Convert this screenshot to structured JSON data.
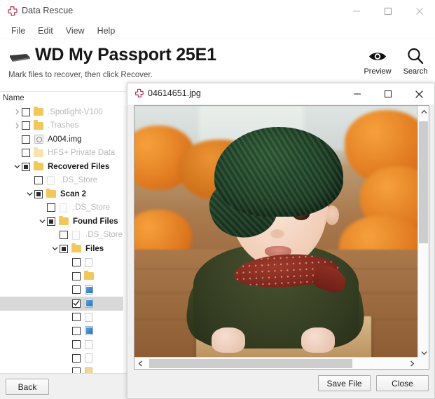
{
  "window": {
    "app_logo": "data-rescue-cross-logo",
    "title": "Data Rescue",
    "controls": {
      "minimize": "minimize-icon",
      "maximize": "maximize-icon",
      "close": "close-icon"
    }
  },
  "menubar": {
    "items": [
      {
        "label": "File"
      },
      {
        "label": "Edit"
      },
      {
        "label": "View"
      },
      {
        "label": "Help"
      }
    ]
  },
  "drive_header": {
    "icon": "hard-drive-icon",
    "title": "WD My Passport 25E1",
    "subtitle": "Mark files to recover, then click Recover.",
    "actions": [
      {
        "icon": "eye-icon",
        "label": "Preview"
      },
      {
        "icon": "search-icon",
        "label": "Search"
      }
    ]
  },
  "list_header": {
    "name_column": "Name"
  },
  "tree": {
    "rows": [
      {
        "indent": 1,
        "twisty": "collapsed",
        "check": "unchecked",
        "icon": "folder",
        "label": ".Spotlight-V100",
        "dim": true,
        "bold": false,
        "selected": false
      },
      {
        "indent": 1,
        "twisty": "collapsed",
        "check": "unchecked",
        "icon": "folder",
        "label": ".Trashes",
        "dim": true,
        "bold": false,
        "selected": false
      },
      {
        "indent": 1,
        "twisty": "none",
        "check": "unchecked",
        "icon": "disk",
        "label": "A004.img",
        "dim": false,
        "bold": false,
        "selected": false
      },
      {
        "indent": 1,
        "twisty": "none",
        "check": "unchecked",
        "icon": "folder-pale",
        "label": "HFS+ Private Data",
        "dim": true,
        "bold": false,
        "selected": false
      },
      {
        "indent": 1,
        "twisty": "expanded",
        "check": "partial",
        "icon": "folder",
        "label": "Recovered Files",
        "dim": false,
        "bold": true,
        "selected": false
      },
      {
        "indent": 2,
        "twisty": "none",
        "check": "unchecked",
        "icon": "doc-pale",
        "label": ".DS_Store",
        "dim": true,
        "bold": false,
        "selected": false
      },
      {
        "indent": 2,
        "twisty": "expanded",
        "check": "partial",
        "icon": "folder",
        "label": "Scan 2",
        "dim": false,
        "bold": true,
        "selected": false
      },
      {
        "indent": 3,
        "twisty": "none",
        "check": "unchecked",
        "icon": "doc-pale",
        "label": ".DS_Store",
        "dim": true,
        "bold": false,
        "selected": false
      },
      {
        "indent": 3,
        "twisty": "expanded",
        "check": "partial",
        "icon": "folder",
        "label": "Found Files",
        "dim": false,
        "bold": true,
        "selected": false
      },
      {
        "indent": 4,
        "twisty": "none",
        "check": "unchecked",
        "icon": "doc-pale",
        "label": ".DS_Store",
        "dim": true,
        "bold": false,
        "selected": false
      },
      {
        "indent": 4,
        "twisty": "expanded",
        "check": "partial",
        "icon": "folder",
        "label": "Files",
        "dim": false,
        "bold": true,
        "selected": false
      },
      {
        "indent": 5,
        "twisty": "none",
        "check": "unchecked",
        "icon": "doc",
        "label": "",
        "dim": false,
        "bold": false,
        "selected": false
      },
      {
        "indent": 5,
        "twisty": "none",
        "check": "unchecked",
        "icon": "folder",
        "label": "",
        "dim": false,
        "bold": false,
        "selected": false
      },
      {
        "indent": 5,
        "twisty": "none",
        "check": "unchecked",
        "icon": "image",
        "label": "",
        "dim": false,
        "bold": false,
        "selected": false
      },
      {
        "indent": 5,
        "twisty": "none",
        "check": "checked",
        "icon": "image",
        "label": "",
        "dim": false,
        "bold": false,
        "selected": true
      },
      {
        "indent": 5,
        "twisty": "none",
        "check": "unchecked",
        "icon": "doc",
        "label": "",
        "dim": false,
        "bold": false,
        "selected": false
      },
      {
        "indent": 5,
        "twisty": "none",
        "check": "unchecked",
        "icon": "image",
        "label": "",
        "dim": false,
        "bold": false,
        "selected": false
      },
      {
        "indent": 5,
        "twisty": "none",
        "check": "unchecked",
        "icon": "doc",
        "label": "",
        "dim": false,
        "bold": false,
        "selected": false
      },
      {
        "indent": 5,
        "twisty": "none",
        "check": "unchecked",
        "icon": "doc",
        "label": "",
        "dim": false,
        "bold": false,
        "selected": false
      },
      {
        "indent": 5,
        "twisty": "none",
        "check": "unchecked",
        "icon": "lock",
        "label": "",
        "dim": false,
        "bold": false,
        "selected": false
      }
    ]
  },
  "bottom_bar": {
    "back_label": "Back"
  },
  "dialog": {
    "logo": "data-rescue-cross-logo",
    "title": "04614651.jpg",
    "controls": {
      "minimize": "minimize-icon",
      "maximize": "maximize-icon",
      "close": "close-icon"
    },
    "image_alt": "baby-in-green-knit-hat-with-pumpkins-photo",
    "scroll": {
      "vertical": "visible",
      "horizontal": "visible"
    },
    "buttons": {
      "save": "Save File",
      "close": "Close"
    }
  },
  "colors": {
    "accent_red": "#b3324a",
    "selection_gray": "#d8d8d8",
    "folder_yellow": "#f2c75c",
    "chrome_gray": "#f0f0f0"
  }
}
